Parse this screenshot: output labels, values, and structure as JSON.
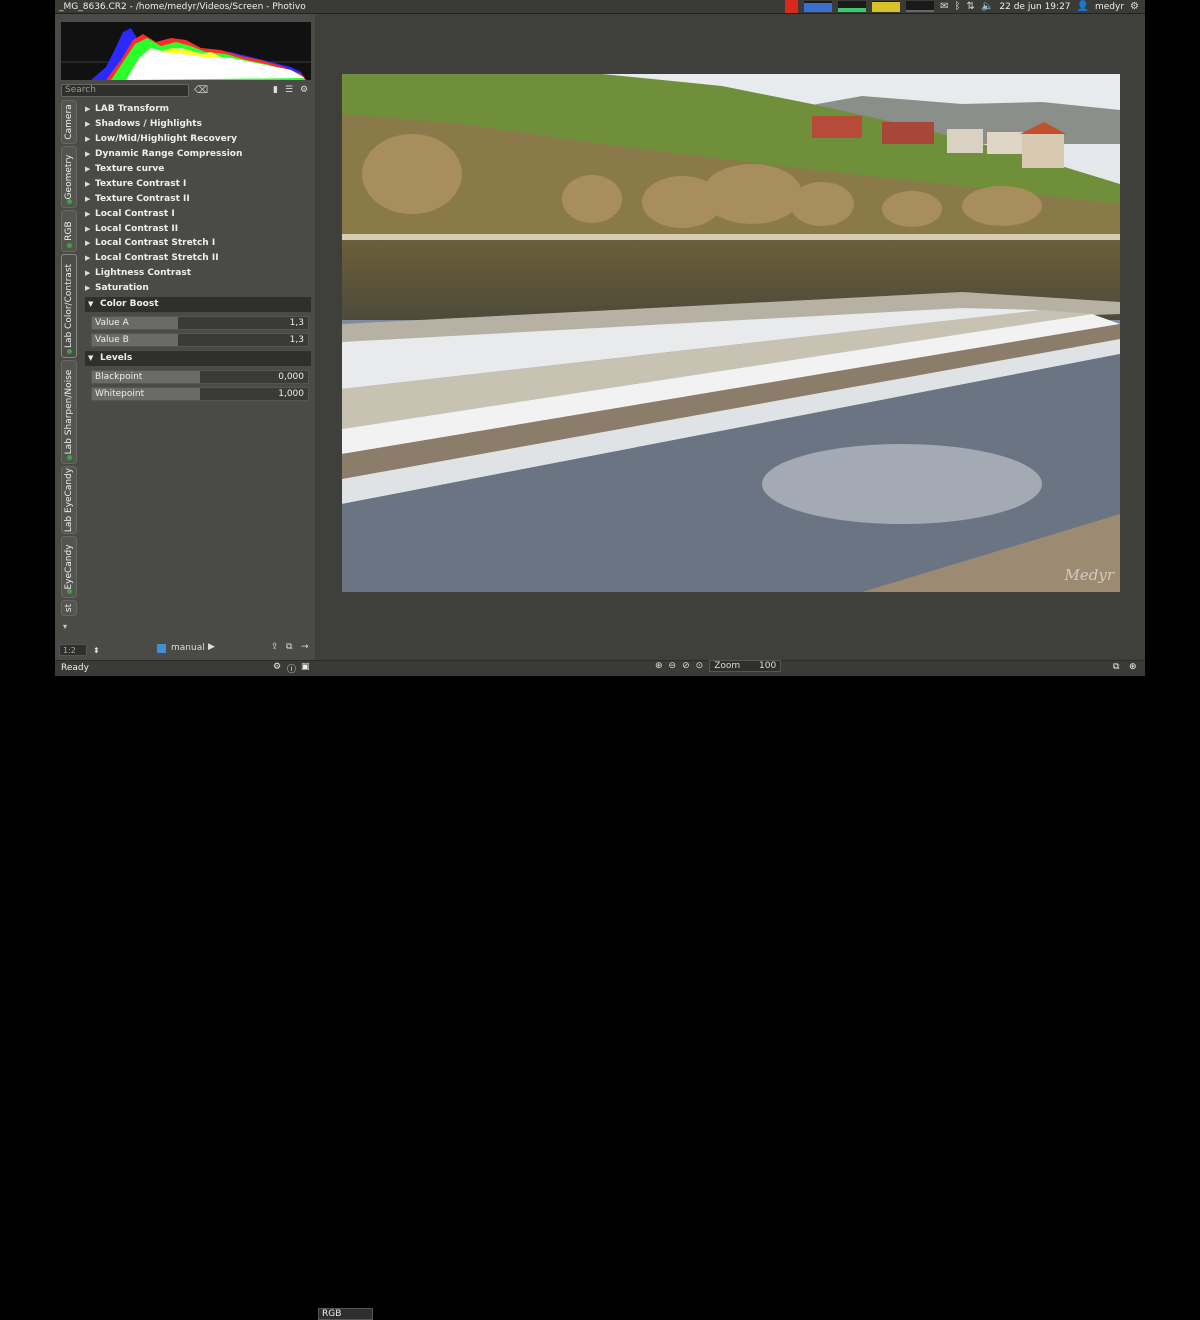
{
  "window": {
    "title": "_MG_8636.CR2 - /home/medyr/Videos/Screen - Photivo"
  },
  "system_tray": {
    "date_time": "22 de jun 19:27",
    "user": "medyr",
    "icons": [
      "record-icon",
      "mail-icon",
      "bluetooth-icon",
      "network-icon",
      "volume-icon",
      "user-icon",
      "gear-icon"
    ]
  },
  "histogram": {
    "colors": {
      "red": "#ff2a2a",
      "green": "#2aff2a",
      "blue": "#2a2aff",
      "yellow": "#ffff2a"
    }
  },
  "search": {
    "placeholder": "Search"
  },
  "tabs": [
    {
      "label": "Camera",
      "has_dot": false
    },
    {
      "label": "Geometry",
      "has_dot": true
    },
    {
      "label": "RGB",
      "has_dot": true
    },
    {
      "label": "Lab Color/Contrast",
      "has_dot": true,
      "active": true
    },
    {
      "label": "Lab Sharpen/Noise",
      "has_dot": true
    },
    {
      "label": "Lab EyeCandy",
      "has_dot": false
    },
    {
      "label": "EyeCandy",
      "has_dot": true
    },
    {
      "label": "st",
      "has_dot": false
    }
  ],
  "filters": [
    "LAB Transform",
    "Shadows / Highlights",
    "Low/Mid/Highlight Recovery",
    "Dynamic Range Compression",
    "Texture curve",
    "Texture Contrast I",
    "Texture Contrast II",
    "Local Contrast I",
    "Local Contrast II",
    "Local Contrast Stretch I",
    "Local Contrast Stretch II",
    "Lightness Contrast",
    "Saturation"
  ],
  "color_boost": {
    "title": "Color Boost",
    "sliders": [
      {
        "label": "Value A",
        "value": "1,3",
        "fill": 0.4
      },
      {
        "label": "Value B",
        "value": "1,3",
        "fill": 0.4
      }
    ]
  },
  "levels": {
    "title": "Levels",
    "sliders": [
      {
        "label": "Blackpoint",
        "value": "0,000",
        "fill": 0.5
      },
      {
        "label": "Whitepoint",
        "value": "1,000",
        "fill": 0.5
      }
    ]
  },
  "bottom": {
    "zoom_select": "1:2",
    "mode_label": "manual",
    "status": "Ready",
    "channel": "RGB",
    "zoom_label": "Zoom",
    "zoom_value": "100"
  },
  "photo": {
    "watermark": "Medyr"
  }
}
